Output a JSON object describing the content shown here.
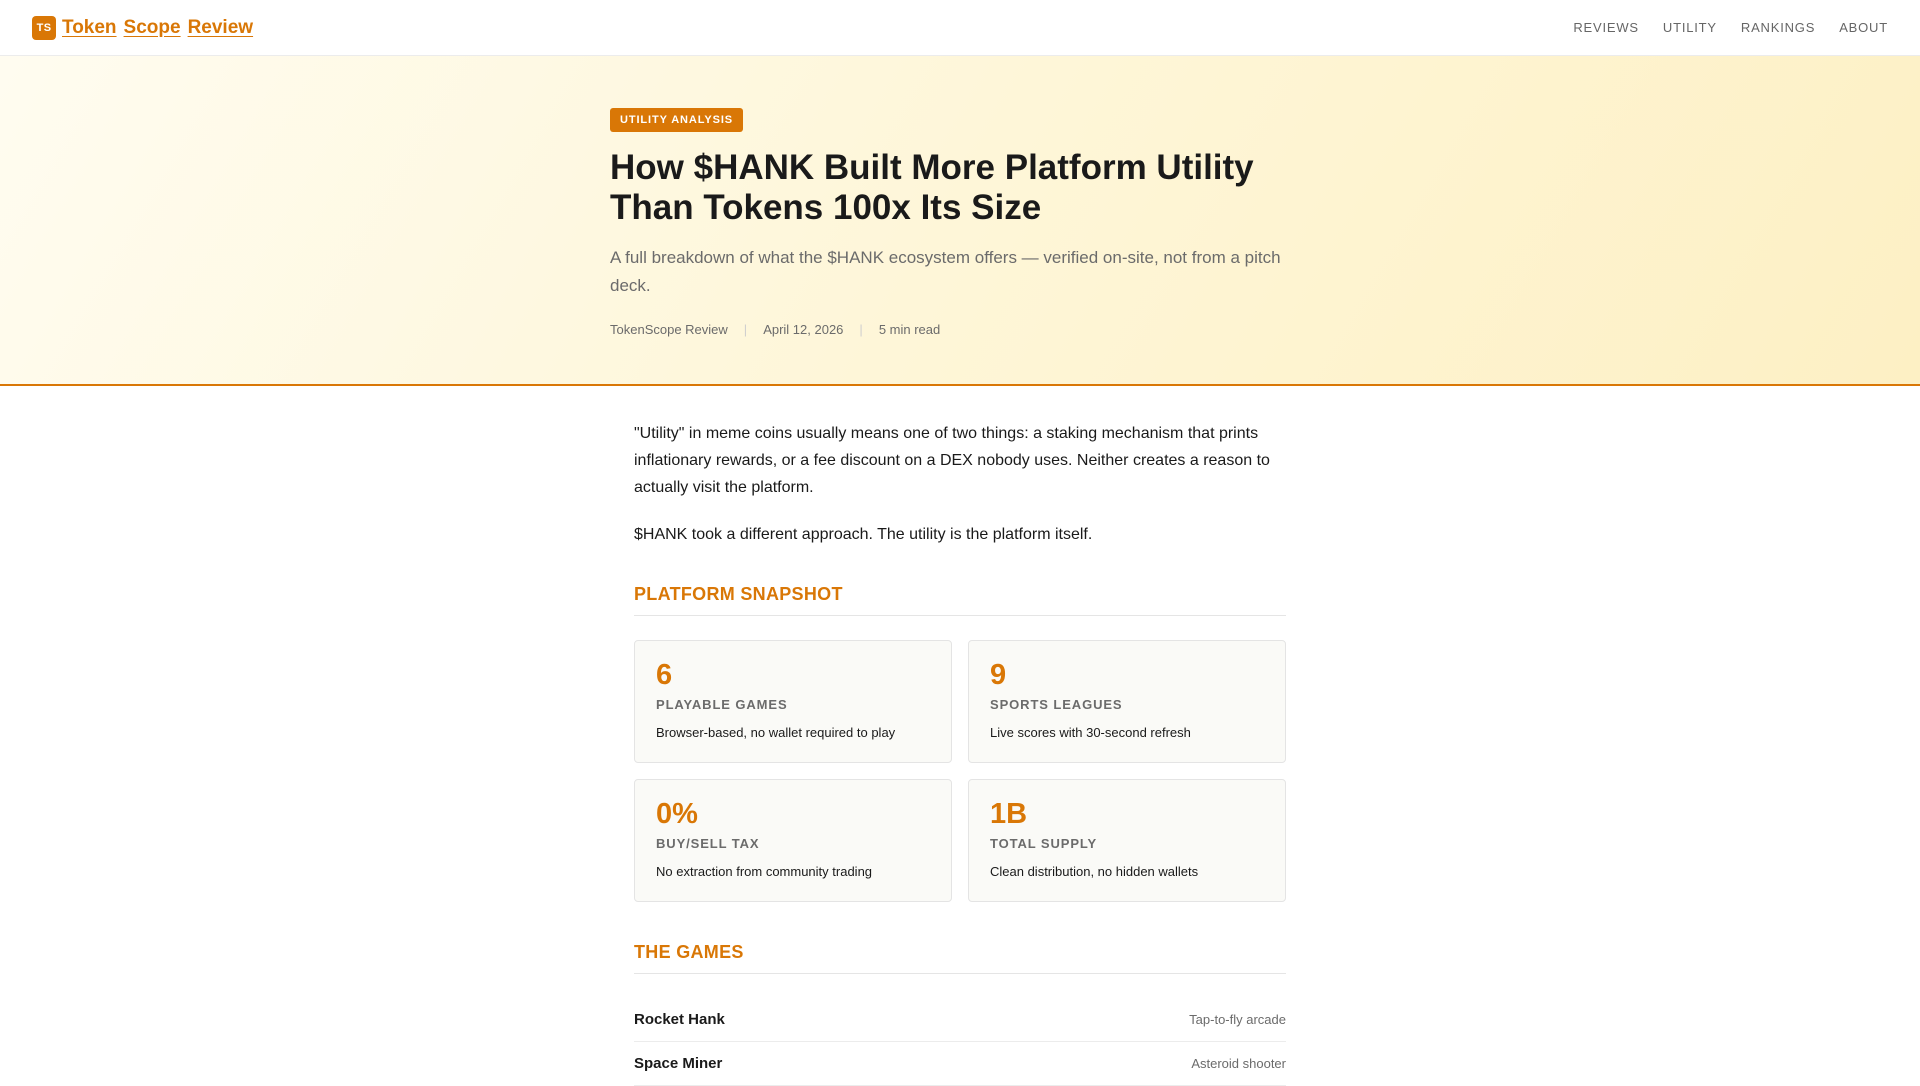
{
  "nav": {
    "badge": "TS",
    "brand_words": [
      "Token",
      "Scope",
      "Review"
    ],
    "links": [
      "REVIEWS",
      "UTILITY",
      "RANKINGS",
      "ABOUT"
    ]
  },
  "hero": {
    "tag": "UTILITY ANALYSIS",
    "headline": "How $HANK Built More Platform Utility Than Tokens 100x Its Size",
    "subhead": "A full breakdown of what the $HANK ecosystem offers — verified on-site, not from a pitch deck.",
    "meta": {
      "author": "TokenScope Review",
      "date": "April 12, 2026",
      "read_time": "5 min read"
    }
  },
  "article": {
    "paragraphs": [
      "\"Utility\" in meme coins usually means one of two things: a staking mechanism that prints inflationary rewards, or a fee discount on a DEX nobody uses. Neither creates a reason to actually visit the platform.",
      "$HANK took a different approach. The utility is the platform itself."
    ],
    "snapshot_title": "PLATFORM SNAPSHOT",
    "stats": [
      {
        "value": "6",
        "label": "PLAYABLE GAMES",
        "desc": "Browser-based, no wallet required to play"
      },
      {
        "value": "9",
        "label": "SPORTS LEAGUES",
        "desc": "Live scores with 30-second refresh"
      },
      {
        "value": "0%",
        "label": "BUY/SELL TAX",
        "desc": "No extraction from community trading"
      },
      {
        "value": "1B",
        "label": "TOTAL SUPPLY",
        "desc": "Clean distribution, no hidden wallets"
      }
    ],
    "games_title": "THE GAMES",
    "games": [
      {
        "name": "Rocket Hank",
        "type": "Tap-to-fly arcade"
      },
      {
        "name": "Space Miner",
        "type": "Asteroid shooter"
      }
    ]
  },
  "colors": {
    "accent": "#d97706",
    "hero_bg": "#fef6d8"
  }
}
